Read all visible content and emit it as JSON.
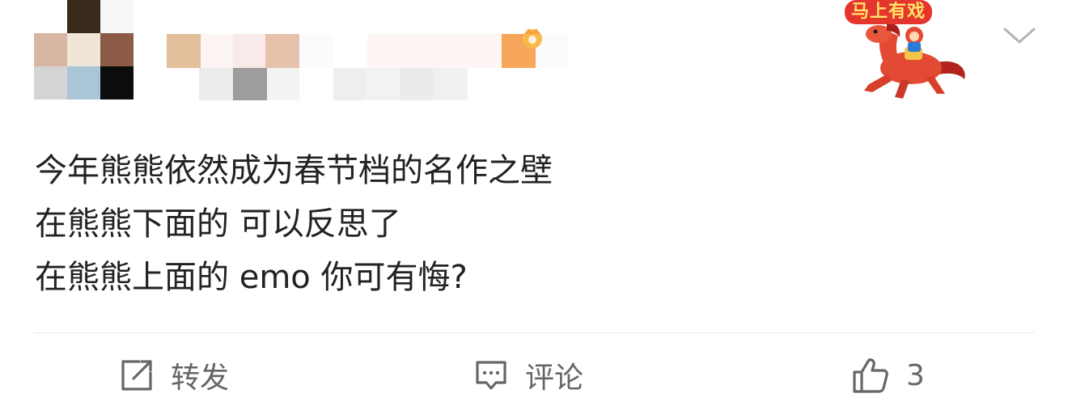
{
  "header": {
    "sticker_caption": "马上有戏",
    "more_icon": "chevron-down-icon"
  },
  "post": {
    "lines": [
      "今年熊熊依然成为春节档的名作之壁",
      "在熊熊下面的 可以反思了",
      "在熊熊上面的 emo 你可有悔?"
    ]
  },
  "actions": {
    "repost": {
      "icon": "share-icon",
      "label": "转发"
    },
    "comment": {
      "icon": "comment-icon",
      "label": "评论"
    },
    "like": {
      "icon": "thumbs-up-icon",
      "count": "3"
    }
  },
  "colors": {
    "text": "#222222",
    "action_text": "#666666",
    "divider": "#e6e6e6",
    "sticker_red": "#e4362c",
    "sticker_yellow": "#ffe36a"
  }
}
